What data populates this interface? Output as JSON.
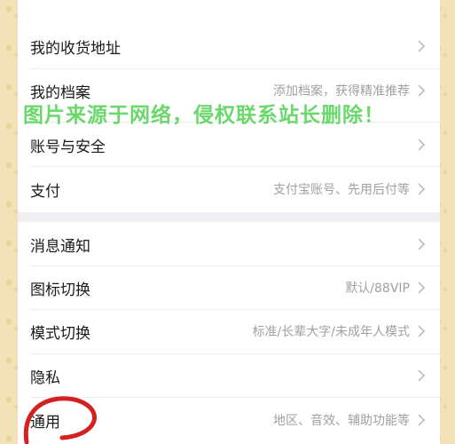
{
  "settings": {
    "group1": [
      {
        "label": "我的收货地址",
        "value": ""
      },
      {
        "label": "我的档案",
        "value": "添加档案，获得精准推荐"
      },
      {
        "label": "账号与安全",
        "value": ""
      },
      {
        "label": "支付",
        "value": "支付宝账号、先用后付等"
      }
    ],
    "group2": [
      {
        "label": "消息通知",
        "value": ""
      },
      {
        "label": "图标切换",
        "value": "默认/88VIP"
      },
      {
        "label": "模式切换",
        "value": "标准/长辈大字/未成年人模式"
      },
      {
        "label": "隐私",
        "value": ""
      },
      {
        "label": "通用",
        "value": "地区、音效、辅助功能等"
      }
    ]
  },
  "watermark": "图片来源于网络，侵权联系站长删除！",
  "colors": {
    "background": "#f3e2b8",
    "watermark": "#6bd86b",
    "annotation": "#d32020"
  },
  "icons": {
    "row_chevron": "chevron-right-icon"
  }
}
